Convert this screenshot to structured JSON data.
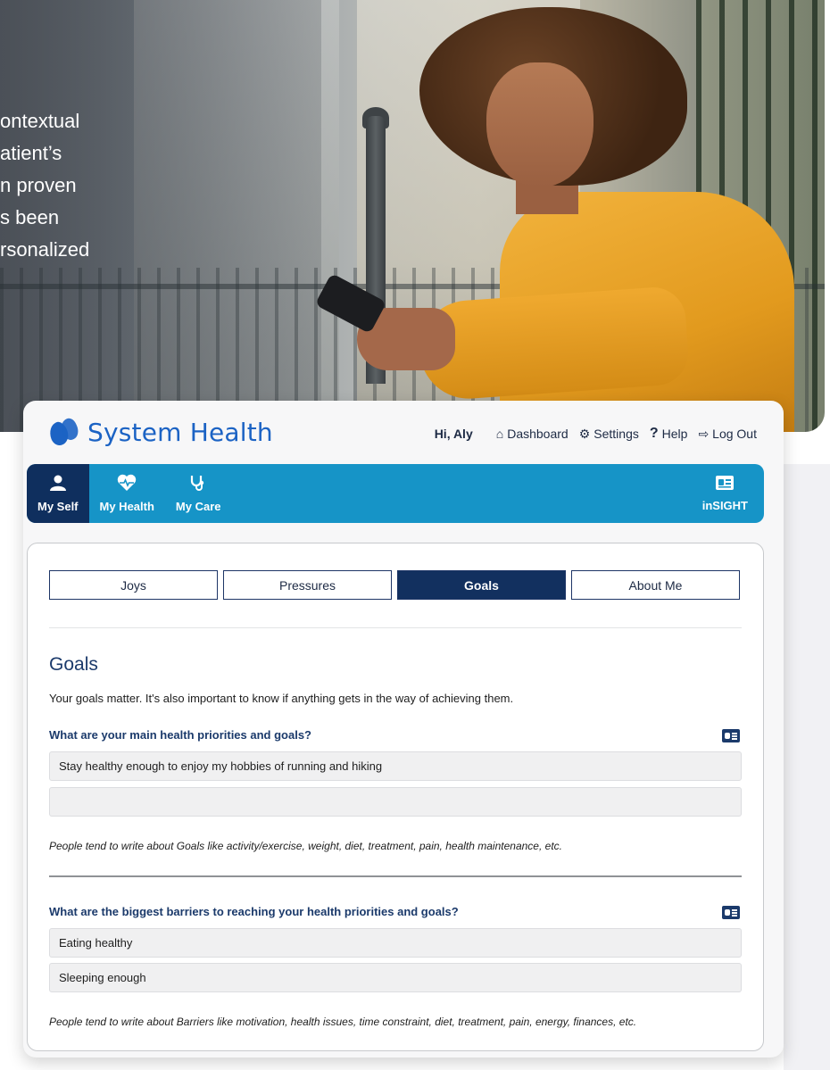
{
  "hero": {
    "lines": [
      "ontextual",
      "atient’s",
      "n proven",
      "s been",
      "rsonalized"
    ]
  },
  "app": {
    "brand": "System Health",
    "greeting": "Hi, Aly",
    "top_links": [
      {
        "label": "Dashboard",
        "icon": "home-icon"
      },
      {
        "label": "Settings",
        "icon": "gear-icon"
      },
      {
        "label": "Help",
        "icon": "question-icon"
      },
      {
        "label": "Log Out",
        "icon": "logout-icon"
      }
    ],
    "main_nav": [
      {
        "label": "My Self",
        "icon": "person-icon",
        "active": true
      },
      {
        "label": "My Health",
        "icon": "heart-pulse-icon",
        "active": false
      },
      {
        "label": "My Care",
        "icon": "stethoscope-icon",
        "active": false
      }
    ],
    "insight": {
      "label": "inSIGHT",
      "icon": "id-card-icon"
    },
    "sub_tabs": [
      {
        "label": "Joys",
        "active": false
      },
      {
        "label": "Pressures",
        "active": false
      },
      {
        "label": "Goals",
        "active": true
      },
      {
        "label": "About Me",
        "active": false
      }
    ],
    "section_title": "Goals",
    "intro": "Your goals matter. It's also important to know if anything gets in the way of achieving them.",
    "q1": {
      "question": "What are your main health priorities and goals?",
      "answers": [
        "Stay healthy enough to enjoy my hobbies of running and hiking",
        ""
      ],
      "hint": "People tend to write about Goals like activity/exercise, weight, diet, treatment, pain, health maintenance, etc."
    },
    "q2": {
      "question": "What are the biggest barriers to reaching your health priorities and goals?",
      "answers": [
        "Eating healthy",
        "Sleeping enough"
      ],
      "hint": "People tend to write about Barriers like motivation, health issues, time constraint, diet, treatment, pain, energy, finances, etc."
    },
    "colors": {
      "brand_blue": "#1c63c4",
      "nav_blue": "#1694c7",
      "navy": "#12305f"
    }
  }
}
